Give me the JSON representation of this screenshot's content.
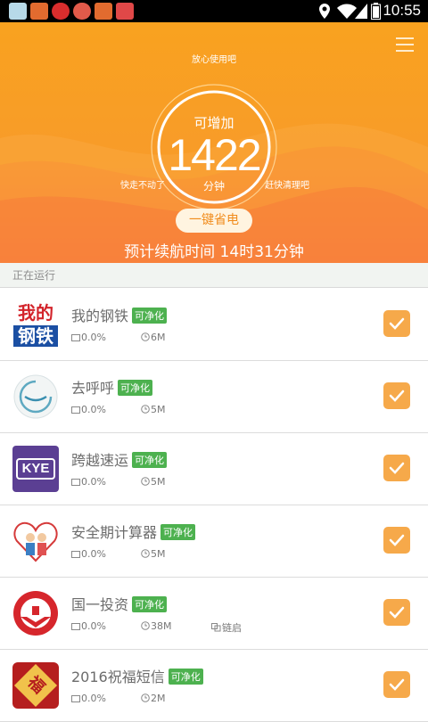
{
  "status_bar": {
    "time": "10:55"
  },
  "hero": {
    "top_tip": "放心使用吧",
    "left_tip": "快走不动了",
    "right_tip": "赶快清理吧",
    "gauge_label": "可增加",
    "gauge_value": "1422",
    "gauge_unit": "分钟",
    "save_button": "一键省电",
    "battery_estimate": "预计续航时间 14时31分钟"
  },
  "section_title": "正在运行",
  "apps": [
    {
      "name": "我的钢铁",
      "badge": "可净化",
      "cpu": "0.0%",
      "mem": "6M",
      "extra": ""
    },
    {
      "name": "去呼呼",
      "badge": "可净化",
      "cpu": "0.0%",
      "mem": "5M",
      "extra": ""
    },
    {
      "name": "跨越速运",
      "badge": "可净化",
      "cpu": "0.0%",
      "mem": "5M",
      "extra": ""
    },
    {
      "name": "安全期计算器",
      "badge": "可净化",
      "cpu": "0.0%",
      "mem": "5M",
      "extra": ""
    },
    {
      "name": "国一投资",
      "badge": "可净化",
      "cpu": "0.0%",
      "mem": "38M",
      "extra": "链启"
    },
    {
      "name": "2016祝福短信",
      "badge": "可净化",
      "cpu": "0.0%",
      "mem": "2M",
      "extra": ""
    }
  ],
  "icons": {
    "app1_text_top": "我的",
    "app1_text_bottom": "钢铁",
    "app3_text": "KYE",
    "app6_text": "福"
  }
}
